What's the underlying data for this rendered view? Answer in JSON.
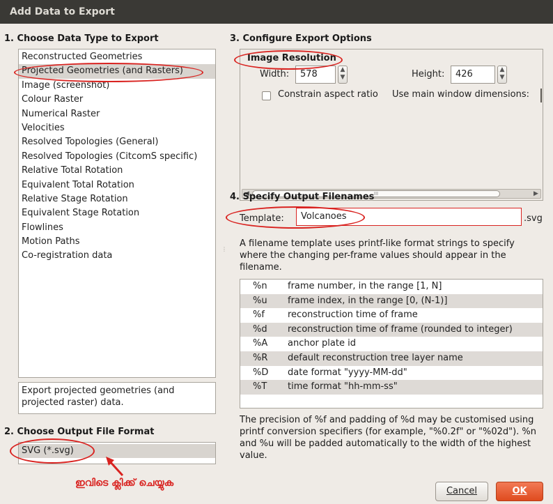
{
  "window": {
    "title": "Add Data to Export"
  },
  "section1": {
    "heading": "1. Choose Data Type to Export",
    "items": [
      "Reconstructed Geometries",
      "Projected Geometries (and Rasters)",
      "Image (screenshot)",
      "Colour Raster",
      "Numerical Raster",
      "Velocities",
      "Resolved Topologies (General)",
      "Resolved Topologies (CitcomS specific)",
      "Relative Total Rotation",
      "Equivalent Total Rotation",
      "Relative Stage Rotation",
      "Equivalent Stage Rotation",
      "Flowlines",
      "Motion Paths",
      "Co-registration data"
    ],
    "selected_index": 1,
    "description": "Export projected geometries (and projected raster) data."
  },
  "section2": {
    "heading": "2. Choose Output File Format",
    "format": "SVG (*.svg)"
  },
  "section3": {
    "heading": "3. Configure Export Options",
    "group_title": "Image Resolution",
    "width_label": "Width:",
    "width_value": "578",
    "height_label": "Height:",
    "height_value": "426",
    "constrain_label": "Constrain aspect ratio",
    "main_window_label": "Use main window dimensions:",
    "scroll_dots": "III"
  },
  "section4": {
    "heading": "4. Specify Output Filenames",
    "template_label": "Template:",
    "template_value": "Volcanoes",
    "extension": ".svg",
    "help_text": "A filename template uses printf-like format strings to specify where the changing per-frame values should appear in the filename.",
    "specifiers": [
      {
        "code": "%n",
        "desc": "frame number, in the range [1, N]"
      },
      {
        "code": "%u",
        "desc": "frame index, in the range [0, (N-1)]"
      },
      {
        "code": "%f",
        "desc": "reconstruction time of frame"
      },
      {
        "code": "%d",
        "desc": "reconstruction time of frame (rounded to integer)"
      },
      {
        "code": "%A",
        "desc": "anchor plate id"
      },
      {
        "code": "%R",
        "desc": "default reconstruction tree layer name"
      },
      {
        "code": "%D",
        "desc": "date format \"yyyy-MM-dd\""
      },
      {
        "code": "%T",
        "desc": "time format \"hh-mm-ss\""
      }
    ],
    "precision_text": "The precision of %f and padding of %d may be customised using printf conversion specifiers (for example, \"%0.2f\" or \"%02d\"). %n and %u will be padded automatically to the width of the highest value."
  },
  "buttons": {
    "cancel": "Cancel",
    "ok": "OK"
  },
  "annotation": {
    "text": "ഇവിടെ ക്ലിക്ക് ചെയ്യുക",
    "color": "#d92320"
  }
}
